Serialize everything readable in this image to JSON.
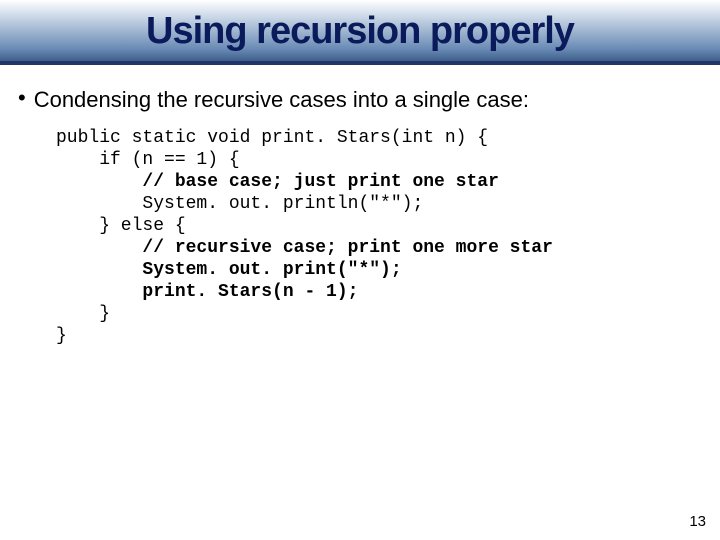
{
  "title": "Using recursion properly",
  "bullet": "Condensing the recursive cases into a single case:",
  "code": {
    "l1": "public static void print. Stars(int n) {",
    "l2": "    if (n == 1) {",
    "l3": "        // base case; just print one star",
    "l4": "        System. out. println(\"*\");",
    "l5": "    } else {",
    "l6": "        // recursive case; print one more star",
    "l7": "        System. out. print(\"*\");",
    "l8": "        print. Stars(n - 1);",
    "l9": "    }",
    "l10": "}"
  },
  "page_number": "13"
}
